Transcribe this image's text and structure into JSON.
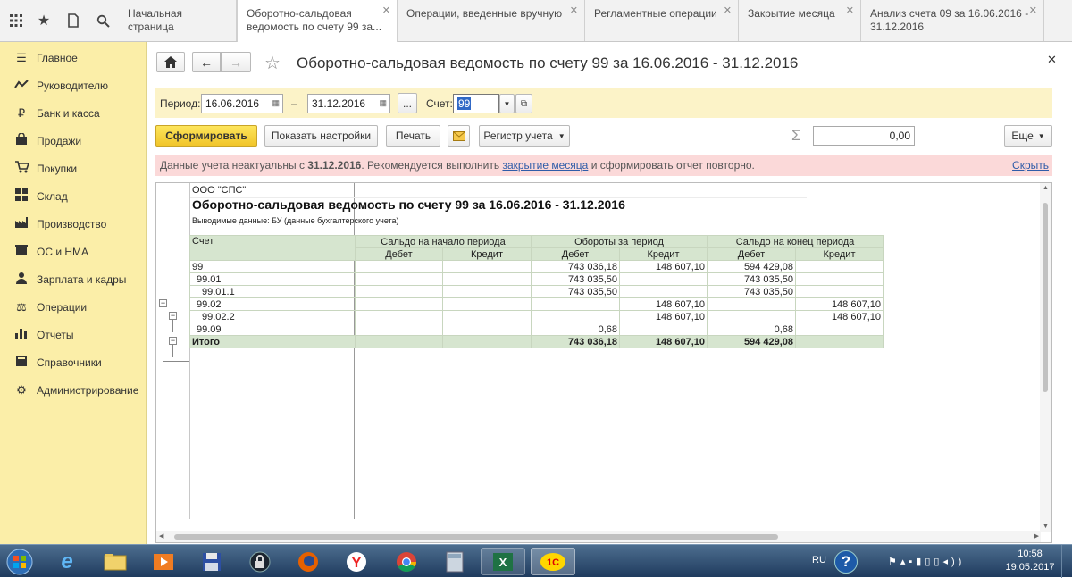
{
  "tabs": [
    {
      "label": "Начальная страница"
    },
    {
      "label": "Оборотно-сальдовая ведомость по счету 99 за..."
    },
    {
      "label": "Операции, введенные вручную"
    },
    {
      "label": "Регламентные операции"
    },
    {
      "label": "Закрытие месяца"
    },
    {
      "label": "Анализ счета 09 за 16.06.2016 - 31.12.2016"
    }
  ],
  "sidebar": {
    "items": [
      {
        "label": "Главное",
        "icon": "menu-icon"
      },
      {
        "label": "Руководителю",
        "icon": "chart-line-icon"
      },
      {
        "label": "Банк и касса",
        "icon": "ruble-icon"
      },
      {
        "label": "Продажи",
        "icon": "bag-icon"
      },
      {
        "label": "Покупки",
        "icon": "cart-icon"
      },
      {
        "label": "Склад",
        "icon": "grid-icon"
      },
      {
        "label": "Производство",
        "icon": "factory-icon"
      },
      {
        "label": "ОС и НМА",
        "icon": "box-icon"
      },
      {
        "label": "Зарплата и кадры",
        "icon": "people-icon"
      },
      {
        "label": "Операции",
        "icon": "scales-icon"
      },
      {
        "label": "Отчеты",
        "icon": "bar-chart-icon"
      },
      {
        "label": "Справочники",
        "icon": "book-icon"
      },
      {
        "label": "Администрирование",
        "icon": "gear-icon"
      }
    ]
  },
  "header": {
    "title": "Оборотно-сальдовая ведомость по счету 99 за 16.06.2016 - 31.12.2016"
  },
  "filters": {
    "period_label": "Период:",
    "date_from": "16.06.2016",
    "dash": "–",
    "date_to": "31.12.2016",
    "dots": "...",
    "account_label": "Счет:",
    "account": "99"
  },
  "toolbar": {
    "generate": "Сформировать",
    "settings": "Показать настройки",
    "print": "Печать",
    "register": "Регистр учета",
    "sum_value": "0,00",
    "more": "Еще"
  },
  "warning": {
    "text1": "Данные учета неактуальны с ",
    "date": "31.12.2016",
    "text2": ". Рекомендуется выполнить ",
    "link": "закрытие месяца",
    "text3": " и сформировать отчет повторно.",
    "hide": "Скрыть"
  },
  "report": {
    "org": "ООО \"СПС\"",
    "title": "Оборотно-сальдовая ведомость по счету 99 за 16.06.2016 - 31.12.2016",
    "subtitle": "Выводимые данные:  БУ (данные бухгалтерского учета)",
    "col_account": "Счет",
    "grp_open": "Сальдо на начало периода",
    "grp_turn": "Обороты за период",
    "grp_close": "Сальдо на конец периода",
    "debit": "Дебет",
    "credit": "Кредит",
    "rows": [
      {
        "acc": "99",
        "od": "",
        "oc": "",
        "td": "743 036,18",
        "tc": "148 607,10",
        "cd": "594 429,08",
        "cc": ""
      },
      {
        "acc": "99.01",
        "od": "",
        "oc": "",
        "td": "743 035,50",
        "tc": "",
        "cd": "743 035,50",
        "cc": ""
      },
      {
        "acc": "99.01.1",
        "od": "",
        "oc": "",
        "td": "743 035,50",
        "tc": "",
        "cd": "743 035,50",
        "cc": ""
      },
      {
        "acc": "99.02",
        "od": "",
        "oc": "",
        "td": "",
        "tc": "148 607,10",
        "cd": "",
        "cc": "148 607,10"
      },
      {
        "acc": "99.02.2",
        "od": "",
        "oc": "",
        "td": "",
        "tc": "148 607,10",
        "cd": "",
        "cc": "148 607,10"
      },
      {
        "acc": "99.09",
        "od": "",
        "oc": "",
        "td": "0,68",
        "tc": "",
        "cd": "0,68",
        "cc": ""
      }
    ],
    "total": {
      "acc": "Итого",
      "td": "743 036,18",
      "tc": "148 607,10",
      "cd": "594 429,08"
    }
  },
  "taskbar": {
    "lang": "RU",
    "time": "10:58",
    "date": "19.05.2017"
  }
}
